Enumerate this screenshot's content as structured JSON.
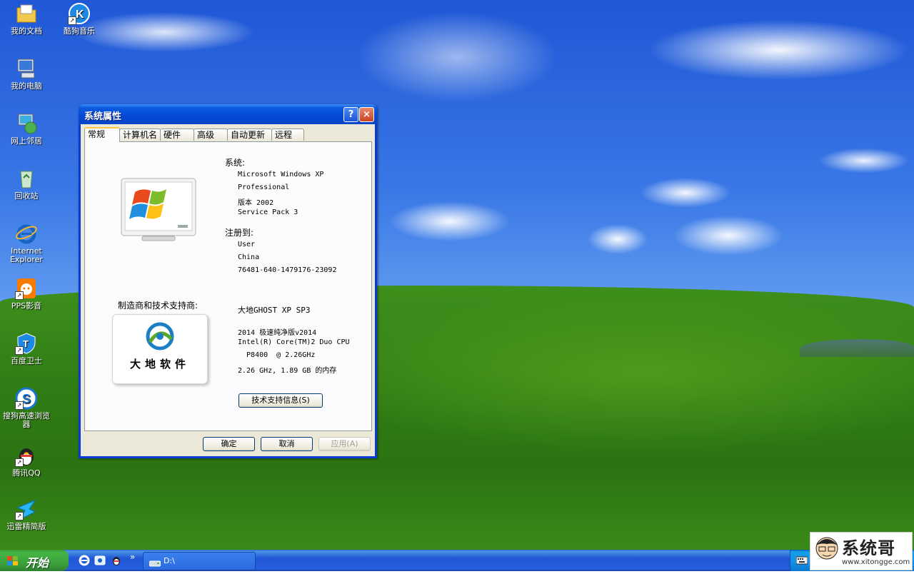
{
  "desktop": {
    "icons": [
      {
        "label": "我的文档",
        "icon": "my-documents-folder-icon"
      },
      {
        "label": "酷狗音乐",
        "icon": "kugou-music-icon"
      },
      {
        "label": "我的电脑",
        "icon": "my-computer-icon"
      },
      {
        "label": "网上邻居",
        "icon": "network-places-icon"
      },
      {
        "label": "回收站",
        "icon": "recycle-bin-icon"
      },
      {
        "label": "Internet Explorer",
        "icon": "internet-explorer-icon"
      },
      {
        "label": "PPS影音",
        "icon": "pps-player-icon"
      },
      {
        "label": "百度卫士",
        "icon": "baidu-guard-icon"
      },
      {
        "label": "搜狗高速浏览器",
        "icon": "sogou-browser-icon"
      },
      {
        "label": "腾讯QQ",
        "icon": "qq-penguin-icon"
      },
      {
        "label": "迅雷精简版",
        "icon": "thunder-icon"
      }
    ]
  },
  "window": {
    "title": "系统属性",
    "help_btn": "?",
    "close_btn": "×",
    "tabs": [
      "常规",
      "计算机名",
      "硬件",
      "高级",
      "自动更新",
      "远程"
    ],
    "active_tab": "常规",
    "system_label": "系统:",
    "system_lines": [
      "Microsoft Windows XP",
      "Professional",
      "版本 2002",
      "Service Pack 3"
    ],
    "registered_label": "注册到:",
    "registered_lines": [
      "User",
      "China",
      "76481-640-1479176-23092"
    ],
    "manufacturer_label": "制造商和技术支持商:",
    "oem_logo_text": "大地软件",
    "oem_lines": [
      "大地GHOST XP SP3",
      "2014 极速纯净版v2014",
      "Intel(R) Core(TM)2 Duo CPU",
      "  P8400  @ 2.26GHz",
      "2.26 GHz, 1.89 GB 的内存"
    ],
    "support_btn": "技术支持信息(S)",
    "ok_btn": "确定",
    "cancel_btn": "取消",
    "apply_btn": "应用(A)"
  },
  "taskbar": {
    "start_label": "开始",
    "expand_glyph": "»",
    "task_item": "D:\\"
  },
  "watermark": {
    "title": "系统哥",
    "url": "www.xitongge.com"
  }
}
